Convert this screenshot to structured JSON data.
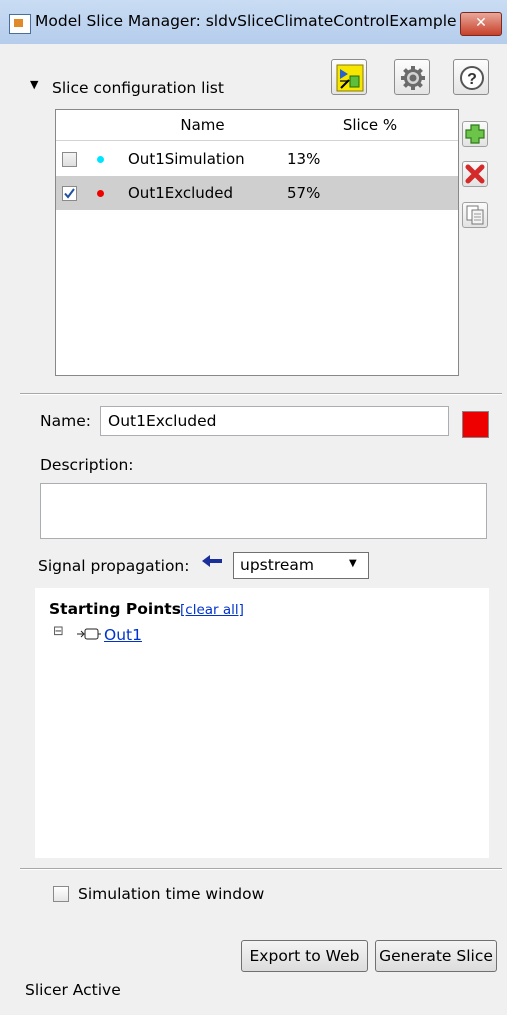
{
  "window": {
    "title": "Model Slice Manager: sldvSliceClimateControlExample",
    "close_glyph": "✕"
  },
  "config_section": {
    "toggle_glyph": "▼",
    "label": "Slice configuration list",
    "toolbar_icons": [
      "highlight-model-icon",
      "gear-icon",
      "help-icon"
    ],
    "help_glyph": "?"
  },
  "table": {
    "columns": [
      "Name",
      "Slice %"
    ],
    "rows": [
      {
        "checked": false,
        "color": "#00e5ff",
        "name": "Out1Simulation",
        "slice": "13%",
        "selected": false
      },
      {
        "checked": true,
        "color": "#ee0000",
        "name": "Out1Excluded",
        "slice": "57%",
        "selected": true
      }
    ],
    "side_buttons": [
      "add-icon",
      "delete-icon",
      "copy-icon"
    ]
  },
  "details": {
    "name_label": "Name:",
    "name_value": "Out1Excluded",
    "color": "#ee0000",
    "description_label": "Description:",
    "description_value": "",
    "propagation_label": "Signal propagation:",
    "propagation_arrow": "🡐",
    "propagation_value": "upstream",
    "propagation_caret": "▼"
  },
  "starting_points": {
    "heading": "Starting Points",
    "clear_link": "[clear all]",
    "expander": "⊟",
    "items": [
      "Out1"
    ]
  },
  "footer": {
    "sim_window_label": "Simulation time window",
    "sim_window_checked": false,
    "export_label": "Export to Web",
    "generate_label": "Generate Slice",
    "status": "Slicer Active"
  }
}
